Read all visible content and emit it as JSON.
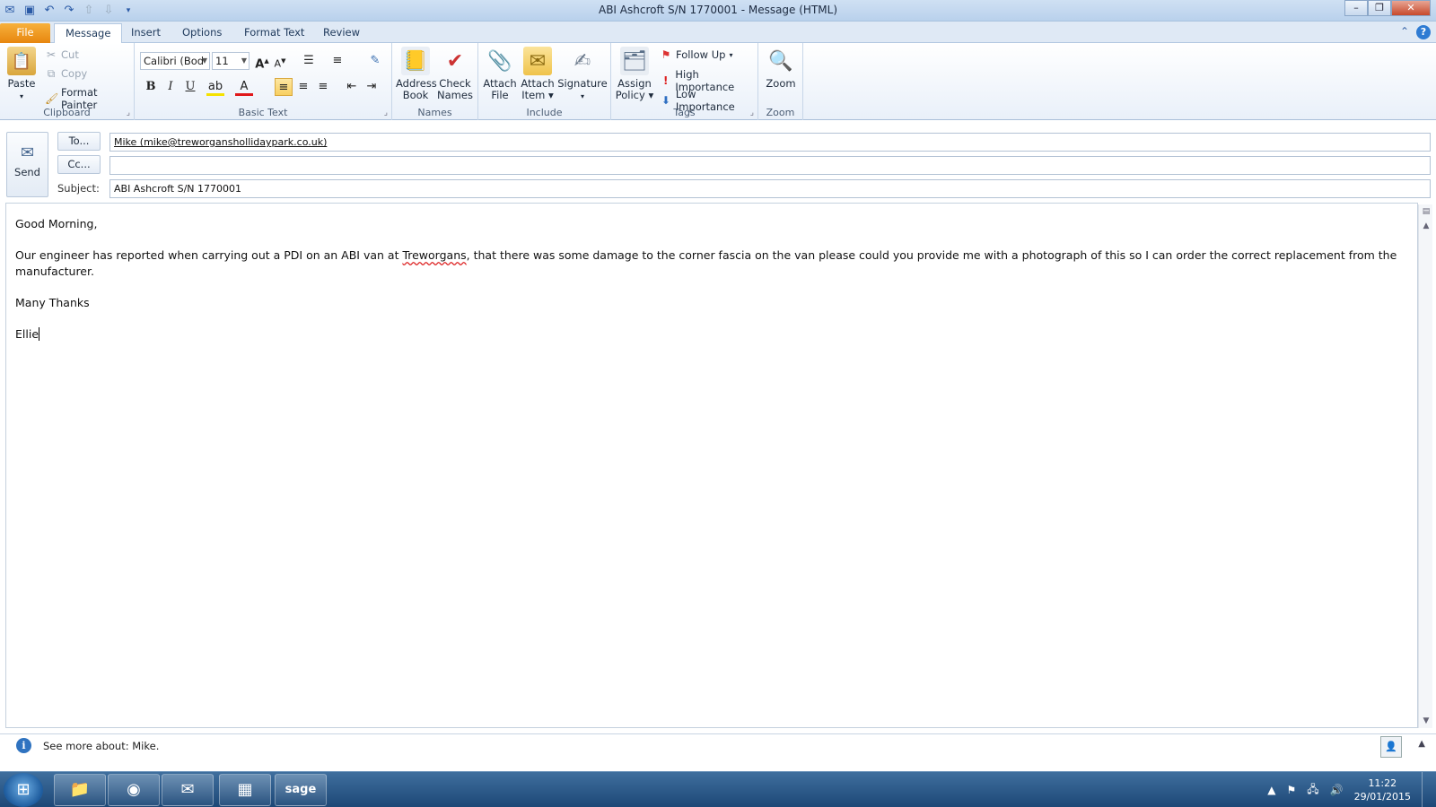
{
  "window": {
    "title": "ABI Ashcroft S/N 1770001  -  Message (HTML)",
    "qat_icons": [
      "outlook-icon",
      "save-icon",
      "undo-icon",
      "redo-icon",
      "up-arrow-icon",
      "down-arrow-icon",
      "customize-icon"
    ]
  },
  "tabs": [
    {
      "label": "File"
    },
    {
      "label": "Message"
    },
    {
      "label": "Insert"
    },
    {
      "label": "Options"
    },
    {
      "label": "Format Text"
    },
    {
      "label": "Review"
    }
  ],
  "ribbon": {
    "clipboard": {
      "label": "Clipboard",
      "paste": "Paste",
      "cut": "Cut",
      "copy": "Copy",
      "format_painter": "Format Painter"
    },
    "basic_text": {
      "label": "Basic Text",
      "font_name": "Calibri (Body)",
      "font_size": "11"
    },
    "names": {
      "label": "Names",
      "address_book_1": "Address",
      "address_book_2": "Book",
      "check_names_1": "Check",
      "check_names_2": "Names"
    },
    "include": {
      "label": "Include",
      "attach_file_1": "Attach",
      "attach_file_2": "File",
      "attach_item_1": "Attach",
      "attach_item_2": "Item",
      "signature": "Signature"
    },
    "tags": {
      "label": "Tags",
      "assign_policy_1": "Assign",
      "assign_policy_2": "Policy",
      "follow_up": "Follow Up",
      "high_importance": "High Importance",
      "low_importance": "Low Importance"
    },
    "zoom": {
      "label": "Zoom",
      "zoom": "Zoom"
    }
  },
  "header": {
    "send": "Send",
    "to_button": "To...",
    "cc_button": "Cc...",
    "subject_label": "Subject:",
    "to_value": "Mike (mike@treworganshollidaypark.co.uk)",
    "cc_value": "",
    "subject_value": "ABI Ashcroft S/N 1770001"
  },
  "body": {
    "greeting": "Good Morning,",
    "para1_a": "Our engineer has reported when carrying out a PDI on an ABI van at ",
    "para1_misspelt": "Treworgans",
    "para1_b": ", that there was some damage to the corner fascia on the van please could you provide me with a photograph of this so I can order the correct replacement from the manufacturer.",
    "closing": "Many Thanks",
    "signature": "Ellie"
  },
  "people_pane": {
    "text": "See more about: Mike."
  },
  "taskbar": {
    "time": "11:22",
    "date": "29/01/2015",
    "apps": [
      "explorer-icon",
      "chrome-icon",
      "outlook-icon",
      "app-grid-icon",
      "sage-icon"
    ],
    "sage_label": "sage"
  }
}
